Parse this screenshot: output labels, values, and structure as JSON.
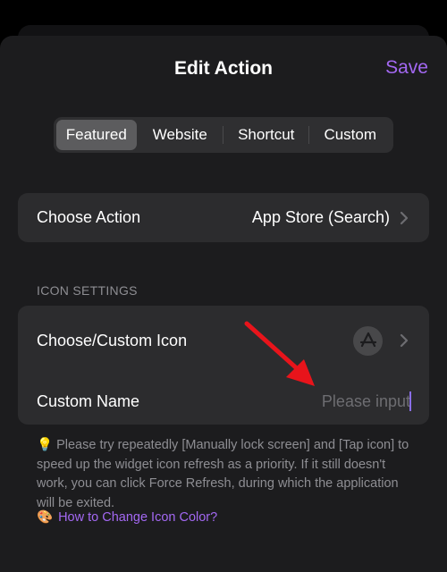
{
  "header": {
    "title": "Edit Action",
    "save_label": "Save"
  },
  "segments": {
    "items": [
      {
        "label": "Featured",
        "active": true
      },
      {
        "label": "Website",
        "active": false
      },
      {
        "label": "Shortcut",
        "active": false
      },
      {
        "label": "Custom",
        "active": false
      }
    ]
  },
  "action": {
    "label": "Choose Action",
    "value": "App Store (Search)"
  },
  "icon_settings": {
    "header": "ICON SETTINGS",
    "choose_icon_label": "Choose/Custom Icon",
    "selected_icon": "app-store-icon",
    "custom_name_label": "Custom Name",
    "custom_name_placeholder": "Please input",
    "custom_name_value": ""
  },
  "tip": {
    "emoji": "💡",
    "text": "Please try repeatedly [Manually lock screen] and [Tap icon] to speed up the widget icon refresh as a priority. If it still doesn't work, you can click Force Refresh, during which the application will be exited."
  },
  "help_link": {
    "emoji": "🎨",
    "label": "How to Change Icon Color?"
  },
  "colors": {
    "accent": "#a368f2",
    "background": "#1c1c1e",
    "card": "#2c2c2e",
    "annotation_arrow": "#e8141b"
  }
}
